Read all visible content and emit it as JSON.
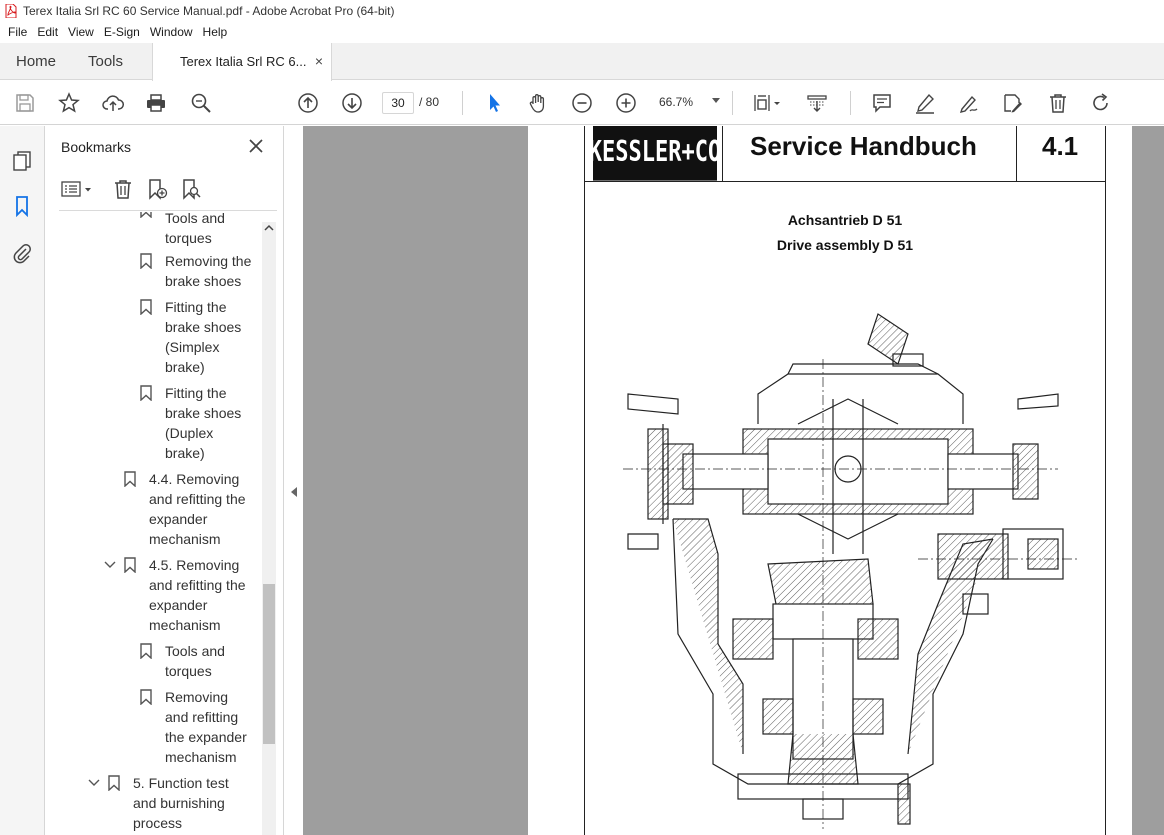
{
  "window": {
    "title": "Terex Italia Srl RC 60 Service Manual.pdf - Adobe Acrobat Pro (64-bit)"
  },
  "menu": [
    "File",
    "Edit",
    "View",
    "E-Sign",
    "Window",
    "Help"
  ],
  "tabs": {
    "home": "Home",
    "tools": "Tools",
    "document": "Terex Italia Srl RC 6...",
    "close": "×"
  },
  "toolbar": {
    "page_current": "30",
    "page_total": "/ 80",
    "zoom": "66.7%"
  },
  "bookmarks": {
    "title": "Bookmarks",
    "items": [
      {
        "label": "Tools and\ntorques",
        "level": 3
      },
      {
        "label": "Removing the\nbrake shoes",
        "level": 3
      },
      {
        "label": "Fitting the\nbrake shoes\n(Simplex\nbrake)",
        "level": 3
      },
      {
        "label": "Fitting the\nbrake shoes\n(Duplex\nbrake)",
        "level": 3
      },
      {
        "label": "4.4. Removing\nand refitting the\nexpander\nmechanism",
        "level": 2
      },
      {
        "label": "4.5. Removing\nand refitting the\nexpander\nmechanism",
        "level": 2,
        "expanded": true
      },
      {
        "label": "Tools and\ntorques",
        "level": 3
      },
      {
        "label": "Removing\nand refitting\nthe expander\nmechanism",
        "level": 3
      },
      {
        "label": "5. Function test\nand burnishing\nprocess",
        "level": 1,
        "expanded": true
      }
    ]
  },
  "document": {
    "logo": "KESSLER+CO",
    "header_title": "Service Handbuch",
    "header_number": "4.1",
    "subtitle_de": "Achsantrieb D 51",
    "subtitle_en": "Drive assembly D 51"
  },
  "colors": {
    "accent_blue": "#1473e6",
    "doc_bg": "#9e9e9e",
    "pdf_red": "#d7191c"
  }
}
